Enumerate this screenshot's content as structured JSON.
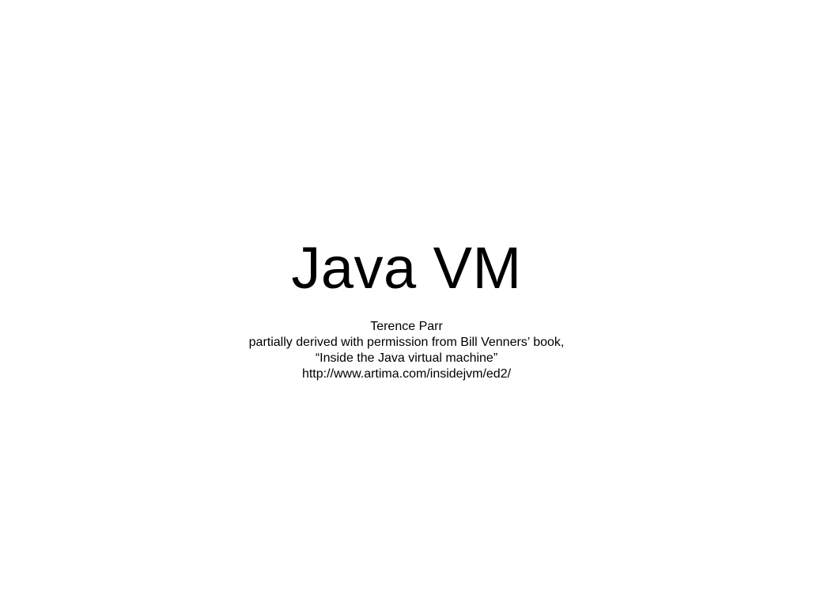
{
  "slide": {
    "title": "Java VM",
    "subtitle_lines": [
      "Terence Parr",
      "partially derived with permission from Bill Venners’ book,",
      "“Inside the Java virtual machine”",
      "http://www.artima.com/insidejvm/ed2/"
    ]
  }
}
